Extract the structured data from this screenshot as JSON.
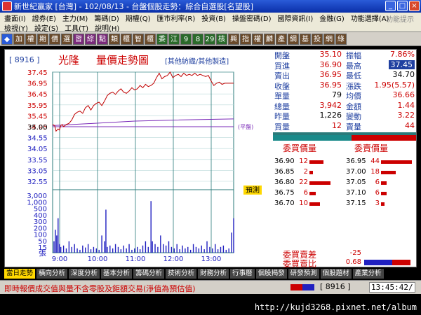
{
  "window": {
    "title": "新世紀贏家 [台灣] - 102/08/13 - 台盤個股走勢：綜合自選股[名望股]",
    "buttons": [
      "_",
      "□",
      "×"
    ]
  },
  "menu": {
    "row1": [
      "畫面(I)",
      "證券(E)",
      "主力(M)",
      "籌碼(D)",
      "期權(Q)",
      "匯市利率(R)",
      "投資(B)",
      "操盤密碼(D)",
      "國際資訊(I)",
      "金融(G)",
      "功能選擇(A)"
    ],
    "row2": [
      "檢視(Y)",
      "設定(S)",
      "工具(T)",
      "說明(H)"
    ],
    "right": "功能提示"
  },
  "toolbar": {
    "buttons": [
      {
        "label": "◆",
        "bg": "#2a5bd8"
      },
      {
        "label": "加",
        "bg": "#6a4a2a"
      },
      {
        "label": "權",
        "bg": "#6a4a2a"
      },
      {
        "label": "期",
        "bg": "#6a4a2a"
      },
      {
        "label": "價",
        "bg": "#6a4a2a"
      },
      {
        "label": "選",
        "bg": "#6a4a2a"
      },
      {
        "label": "習",
        "bg": "#7a2a7a"
      },
      {
        "label": "綜",
        "bg": "#7a2a7a"
      },
      {
        "label": "點",
        "bg": "#7a2a7a"
      },
      {
        "label": "類",
        "bg": "#6a4a2a"
      },
      {
        "label": "櫃",
        "bg": "#6a4a2a"
      },
      {
        "label": "智",
        "bg": "#6a4a2a"
      },
      {
        "label": "櫃",
        "bg": "#6a4a2a"
      },
      {
        "label": "委",
        "bg": "#2a6a2a"
      },
      {
        "label": "江",
        "bg": "#2a6a2a"
      },
      {
        "label": "9",
        "bg": "#2a6a2a"
      },
      {
        "label": "8",
        "bg": "#2a6a2a"
      },
      {
        "label": "29",
        "bg": "#2a6a2a"
      },
      {
        "label": "核",
        "bg": "#2a6a2a"
      },
      {
        "label": "興",
        "bg": "#6a4a2a"
      },
      {
        "label": "指",
        "bg": "#6a4a2a"
      },
      {
        "label": "權",
        "bg": "#6a4a2a"
      },
      {
        "label": "麟",
        "bg": "#6a4a2a"
      },
      {
        "label": "產",
        "bg": "#6a4a2a"
      },
      {
        "label": "綱",
        "bg": "#6a4a2a"
      },
      {
        "label": "基",
        "bg": "#6a4a2a"
      },
      {
        "label": "投",
        "bg": "#6a4a2a"
      },
      {
        "label": "網",
        "bg": "#6a4a2a"
      },
      {
        "label": "綠",
        "bg": "#6a4a2a"
      }
    ]
  },
  "stock": {
    "code": "[ 8916 ]",
    "name": "光隆",
    "chart_title": "量價走勢圖",
    "sector": "[其他紡織/其他製造]"
  },
  "quote": {
    "rows": [
      {
        "la": "開盤",
        "va": "35.10",
        "lb": "振幅",
        "vb": "7.86%",
        "ca": "#c00",
        "cb": "#c00"
      },
      {
        "la": "買進",
        "va": "36.90",
        "lb": "最高",
        "vb": "37.45",
        "ca": "#c00",
        "cb": "#fff",
        "hl": true
      },
      {
        "la": "賣出",
        "va": "36.95",
        "lb": "最低",
        "vb": "34.70",
        "ca": "#c00",
        "cb": "#000"
      },
      {
        "la": "收盤",
        "va": "36.95",
        "lb": "漲跌",
        "vb": "1.95(5.57)",
        "ca": "#c00",
        "cb": "#c00"
      },
      {
        "la": "單量",
        "va": "79",
        "lb": "均價",
        "vb": "36.66",
        "ca": "#000",
        "cb": "#c00"
      },
      {
        "la": "總量",
        "va": "3,942",
        "lb": "金額",
        "vb": "1.44",
        "ca": "#c00",
        "cb": "#c00"
      },
      {
        "la": "昨量",
        "va": "1,226",
        "lb": "變動",
        "vb": "3.22",
        "ca": "#000",
        "cb": "#c00"
      },
      {
        "la": "買量",
        "va": "12",
        "lb": "賣量",
        "vb": "44",
        "ca": "#c00",
        "cb": "#c00"
      }
    ]
  },
  "order_book": {
    "bid_title": "委買價量",
    "ask_title": "委賣價量",
    "bids": [
      {
        "price": "36.90",
        "qty": "12",
        "w": 26
      },
      {
        "price": "36.85",
        "qty": "2",
        "w": 6
      },
      {
        "price": "36.80",
        "qty": "22",
        "w": 40
      },
      {
        "price": "36.75",
        "qty": "6",
        "w": 12
      },
      {
        "price": "36.70",
        "qty": "10",
        "w": 20
      }
    ],
    "asks": [
      {
        "price": "36.95",
        "qty": "44",
        "w": 58
      },
      {
        "price": "37.00",
        "qty": "18",
        "w": 28
      },
      {
        "price": "37.05",
        "qty": "6",
        "w": 10
      },
      {
        "price": "37.10",
        "qty": "6",
        "w": 10
      },
      {
        "price": "37.15",
        "qty": "3",
        "w": 6
      }
    ]
  },
  "summary": {
    "diff_label": "委買賣差",
    "diff_value": "-25",
    "ratio_label": "委買賣比",
    "ratio_value": "0.68"
  },
  "tabs": [
    "當日走勢",
    "橫向分析",
    "深度分析",
    "基本分析",
    "籌碼分析",
    "技術分析",
    "財務分析",
    "行事曆",
    "個股揭發",
    "研發預測",
    "個股題材",
    "產業分析"
  ],
  "status": {
    "message": "即時報價成交值與量不含零股及鉅額交易(淨值為預估值)",
    "code": "[ 8916 ]",
    "time": "13:45:42/"
  },
  "watermark": "http://kujd3268.pixnet.net/album",
  "chart_data": {
    "type": "line",
    "price_ticks": [
      "37.45",
      "36.95",
      "36.45",
      "35.95",
      "35.45",
      "34.95",
      "34.55",
      "34.05",
      "33.55",
      "33.05",
      "32.55"
    ],
    "ylim": [
      32.55,
      37.45
    ],
    "reference_price": 35.0,
    "reference_label": "35.00",
    "reference_note": "(平盤)",
    "forecast_label": "預測",
    "volume_ticks": [
      "3,000",
      "1,000",
      "500",
      "400",
      "300",
      "200",
      "100",
      "50",
      "15"
    ],
    "volume_unit": "張",
    "time_ticks": [
      "9:00",
      "10:00",
      "11:00",
      "12:00",
      "13:00"
    ],
    "price_series": [
      [
        0,
        35.1
      ],
      [
        3,
        35.05
      ],
      [
        5,
        34.8
      ],
      [
        8,
        34.9
      ],
      [
        10,
        34.85
      ],
      [
        12,
        35.05
      ],
      [
        14,
        35.1
      ],
      [
        16,
        35.0
      ],
      [
        20,
        35.1
      ],
      [
        24,
        35.15
      ],
      [
        28,
        35.3
      ],
      [
        32,
        35.55
      ],
      [
        36,
        35.65
      ],
      [
        40,
        35.7
      ],
      [
        44,
        35.6
      ],
      [
        48,
        35.85
      ],
      [
        52,
        35.95
      ],
      [
        56,
        35.75
      ],
      [
        60,
        35.95
      ],
      [
        64,
        36.05
      ],
      [
        68,
        36.1
      ],
      [
        72,
        35.95
      ],
      [
        76,
        36.15
      ],
      [
        80,
        36.4
      ],
      [
        84,
        36.5
      ],
      [
        88,
        36.55
      ],
      [
        92,
        36.45
      ],
      [
        96,
        36.6
      ],
      [
        100,
        36.7
      ],
      [
        104,
        36.55
      ],
      [
        108,
        36.5
      ],
      [
        112,
        36.6
      ],
      [
        116,
        36.75
      ],
      [
        120,
        36.65
      ],
      [
        124,
        36.7
      ],
      [
        128,
        36.85
      ],
      [
        132,
        36.75
      ],
      [
        136,
        36.9
      ],
      [
        140,
        36.8
      ],
      [
        144,
        36.85
      ],
      [
        148,
        36.95
      ],
      [
        152,
        37.2
      ],
      [
        156,
        37.4
      ],
      [
        160,
        37.15
      ],
      [
        164,
        37.25
      ],
      [
        168,
        37.3
      ],
      [
        172,
        37.45
      ],
      [
        176,
        37.2
      ],
      [
        180,
        37.3
      ],
      [
        184,
        37.35
      ],
      [
        188,
        37.25
      ],
      [
        192,
        37.4
      ],
      [
        196,
        37.3
      ],
      [
        200,
        37.35
      ],
      [
        204,
        37.3
      ],
      [
        208,
        37.4
      ],
      [
        212,
        37.3
      ],
      [
        216,
        37.35
      ],
      [
        220,
        37.3
      ],
      [
        224,
        37.25
      ],
      [
        228,
        37.3
      ],
      [
        232,
        37.05
      ],
      [
        236,
        36.85
      ],
      [
        240,
        36.95
      ],
      [
        244,
        37.0
      ],
      [
        248,
        36.9
      ],
      [
        252,
        36.95
      ],
      [
        256,
        36.95
      ],
      [
        260,
        36.95
      ],
      [
        265,
        36.95
      ]
    ],
    "avg_series": [
      [
        0,
        35.05
      ],
      [
        60,
        35.15
      ],
      [
        120,
        35.25
      ],
      [
        180,
        35.3
      ],
      [
        265,
        35.35
      ]
    ],
    "volume_series": [
      [
        2,
        40
      ],
      [
        4,
        80
      ],
      [
        6,
        60
      ],
      [
        8,
        120
      ],
      [
        10,
        30
      ],
      [
        12,
        20
      ],
      [
        16,
        25
      ],
      [
        20,
        15
      ],
      [
        24,
        40
      ],
      [
        28,
        20
      ],
      [
        32,
        30
      ],
      [
        36,
        15
      ],
      [
        40,
        10
      ],
      [
        44,
        25
      ],
      [
        48,
        18
      ],
      [
        52,
        30
      ],
      [
        56,
        12
      ],
      [
        60,
        20
      ],
      [
        64,
        15
      ],
      [
        68,
        10
      ],
      [
        72,
        60
      ],
      [
        76,
        40
      ],
      [
        78,
        150
      ],
      [
        80,
        20
      ],
      [
        84,
        25
      ],
      [
        88,
        15
      ],
      [
        92,
        30
      ],
      [
        96,
        20
      ],
      [
        100,
        12
      ],
      [
        104,
        25
      ],
      [
        108,
        15
      ],
      [
        112,
        30
      ],
      [
        116,
        10
      ],
      [
        120,
        15
      ],
      [
        124,
        20
      ],
      [
        128,
        12
      ],
      [
        132,
        25
      ],
      [
        136,
        40
      ],
      [
        140,
        20
      ],
      [
        144,
        180
      ],
      [
        146,
        40
      ],
      [
        150,
        30
      ],
      [
        154,
        20
      ],
      [
        158,
        60
      ],
      [
        162,
        30
      ],
      [
        166,
        25
      ],
      [
        170,
        40
      ],
      [
        174,
        20
      ],
      [
        178,
        15
      ],
      [
        182,
        30
      ],
      [
        186,
        12
      ],
      [
        190,
        25
      ],
      [
        194,
        15
      ],
      [
        198,
        20
      ],
      [
        202,
        10
      ],
      [
        206,
        30
      ],
      [
        210,
        20
      ],
      [
        214,
        15
      ],
      [
        218,
        25
      ],
      [
        222,
        12
      ],
      [
        226,
        40
      ],
      [
        230,
        20
      ],
      [
        234,
        15
      ],
      [
        238,
        30
      ],
      [
        242,
        12
      ],
      [
        246,
        20
      ],
      [
        250,
        25
      ],
      [
        254,
        10
      ],
      [
        258,
        15
      ],
      [
        262,
        70
      ],
      [
        265,
        120
      ]
    ],
    "colors": {
      "price": "#c00000",
      "avg": "#7a2ab8",
      "grid": "#2a7a7a",
      "volume": "#2020c0",
      "reference": "#7a2ab8"
    }
  }
}
